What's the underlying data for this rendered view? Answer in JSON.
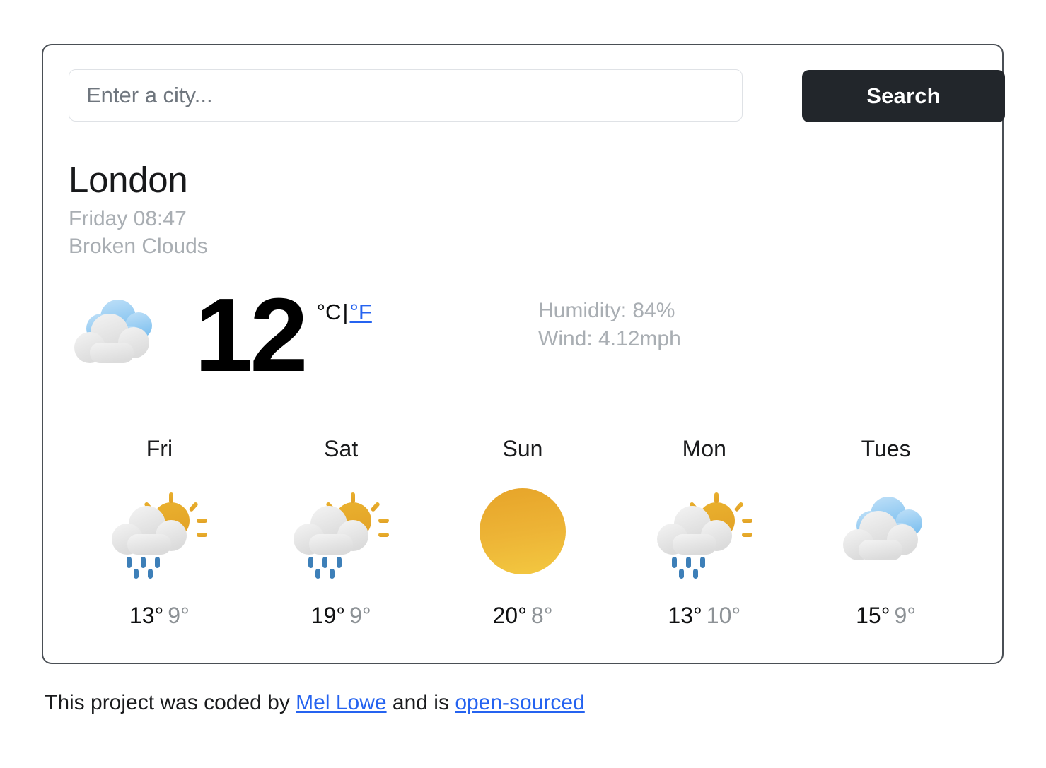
{
  "search": {
    "placeholder": "Enter a city...",
    "value": "",
    "button_label": "Search"
  },
  "current": {
    "city": "London",
    "date_time": "Friday 08:47",
    "description": "Broken Clouds",
    "icon": "broken-clouds-icon",
    "temperature": "12",
    "unit_active": "°C",
    "unit_separator": "|",
    "unit_link": "°F",
    "humidity": "Humidity: 84%",
    "wind": "Wind: 4.12mph"
  },
  "forecast": [
    {
      "day": "Fri",
      "icon": "rain-sun-icon",
      "temp_max": "13°",
      "temp_min": "9°"
    },
    {
      "day": "Sat",
      "icon": "rain-sun-icon",
      "temp_max": "19°",
      "temp_min": "9°"
    },
    {
      "day": "Sun",
      "icon": "sun-icon",
      "temp_max": "20°",
      "temp_min": "8°"
    },
    {
      "day": "Mon",
      "icon": "rain-sun-icon",
      "temp_max": "13°",
      "temp_min": "10°"
    },
    {
      "day": "Tues",
      "icon": "broken-clouds-icon",
      "temp_max": "15°",
      "temp_min": "9°"
    }
  ],
  "footer": {
    "text_before": "This project was coded by ",
    "author_link": "Mel Lowe",
    "text_middle": " and is ",
    "source_link": "open-sourced"
  },
  "colors": {
    "accent_link": "#2563f0",
    "button_bg": "#22262b",
    "muted_text": "#a9aeb3",
    "cloud_blue": "#8ec5f0",
    "cloud_white": "#ededed",
    "sun_gold": "#e8a82a",
    "rain_blue": "#3d7fb8"
  }
}
